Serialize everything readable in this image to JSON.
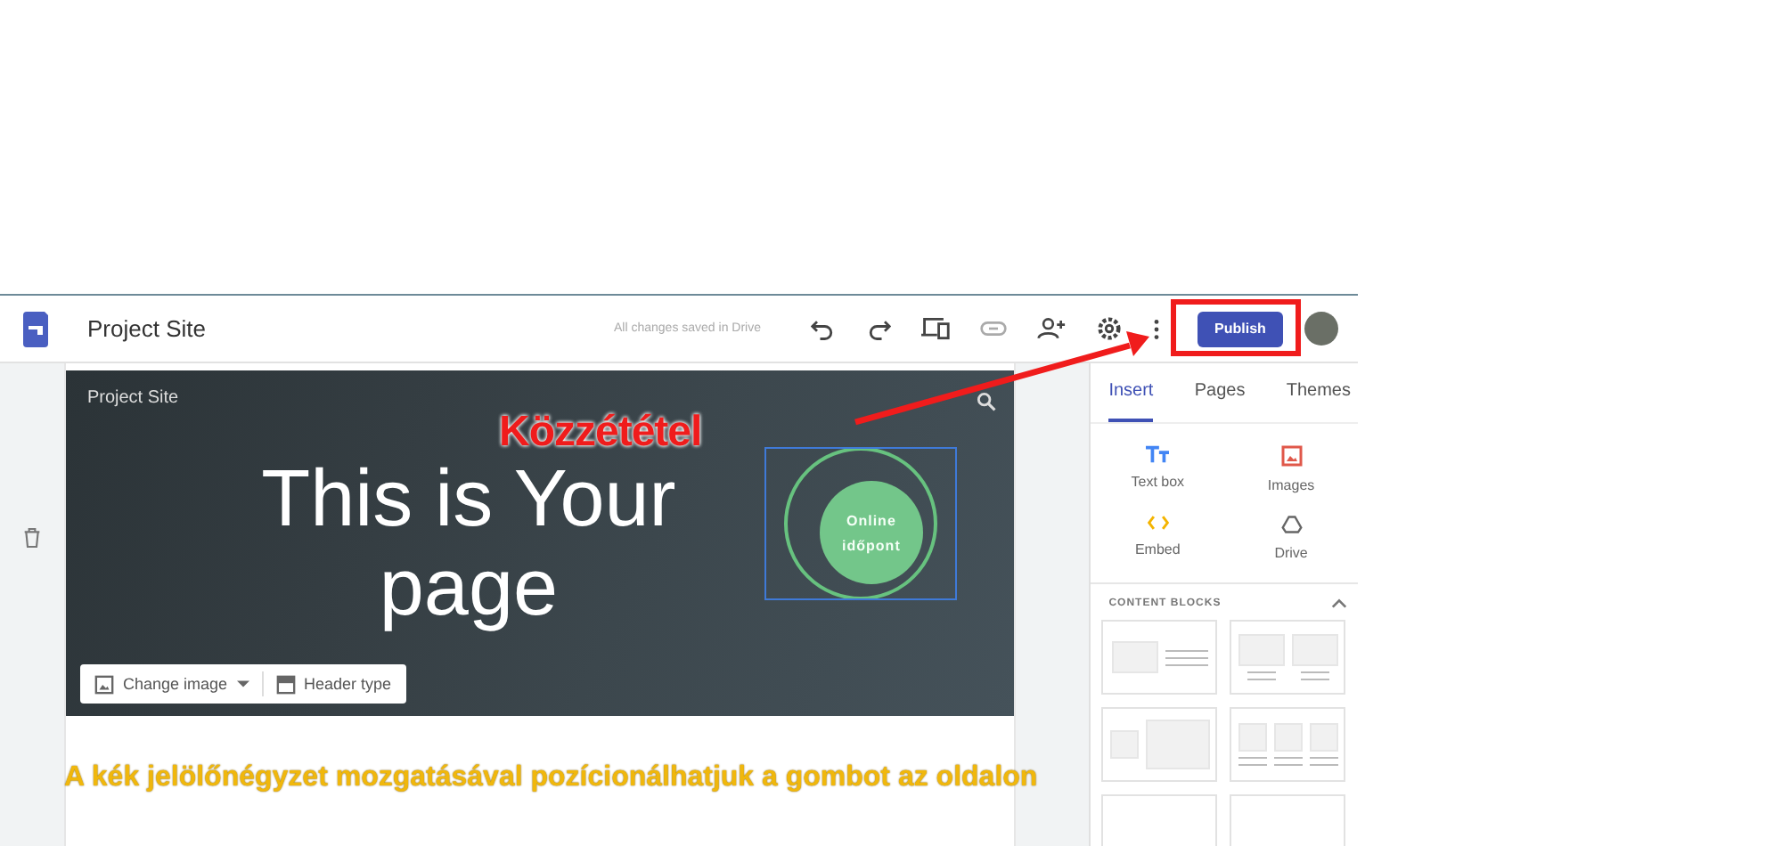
{
  "app_bar": {
    "title": "Project Site",
    "save_status": "All changes saved in Drive",
    "publish_label": "Publish"
  },
  "header": {
    "site_title": "Project Site",
    "heading_lines": [
      "This is Your",
      "page"
    ],
    "button_lines": [
      "Online",
      "időpont"
    ],
    "toolbar": [
      "Change image",
      "Header type"
    ]
  },
  "panel": {
    "tabs": [
      {
        "label": "Insert",
        "selected": true
      },
      {
        "label": "Pages",
        "selected": false
      },
      {
        "label": "Themes",
        "selected": false
      }
    ],
    "insert_items": [
      {
        "label": "Text box",
        "kind": "textbox"
      },
      {
        "label": "Images",
        "kind": "images"
      },
      {
        "label": "Embed",
        "kind": "embed"
      },
      {
        "label": "Drive",
        "kind": "drive"
      }
    ],
    "section_title": "CONTENT BLOCKS",
    "expanded": true,
    "blocks": [
      {
        "kind": "image-text"
      },
      {
        "kind": "two-images"
      },
      {
        "kind": "image-wide"
      },
      {
        "kind": "three-images"
      }
    ]
  },
  "annotations": {
    "callout": "Közzététel",
    "caption": "A kék jelölőnégyzet mozgatásával pozícionálhatjuk a gombot az oldalon"
  }
}
